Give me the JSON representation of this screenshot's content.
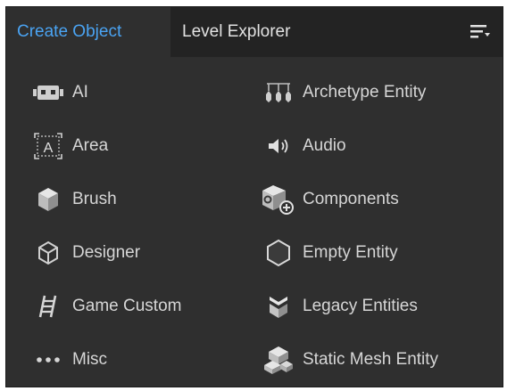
{
  "tabs": [
    {
      "label": "Create Object",
      "active": true
    },
    {
      "label": "Level Explorer",
      "active": false
    }
  ],
  "menu_icon": "sort-menu-icon",
  "colors": {
    "accent": "#4aa3f2",
    "panel_bg": "#2f2f2f",
    "tabbar_bg": "#232323",
    "text": "#d6d6d6"
  },
  "left_items": [
    {
      "label": "AI",
      "icon": "ai-robot-icon"
    },
    {
      "label": "Area",
      "icon": "area-icon"
    },
    {
      "label": "Brush",
      "icon": "brush-cube-icon"
    },
    {
      "label": "Designer",
      "icon": "designer-hexagon-icon"
    },
    {
      "label": "Game Custom",
      "icon": "ladder-icon"
    },
    {
      "label": "Misc",
      "icon": "ellipsis-icon"
    }
  ],
  "right_items": [
    {
      "label": "Archetype Entity",
      "icon": "archetype-icon"
    },
    {
      "label": "Audio",
      "icon": "speaker-icon"
    },
    {
      "label": "Components",
      "icon": "components-icon"
    },
    {
      "label": "Empty Entity",
      "icon": "hexagon-icon"
    },
    {
      "label": "Legacy Entities",
      "icon": "legacy-entity-icon"
    },
    {
      "label": "Static Mesh Entity",
      "icon": "static-mesh-icon"
    }
  ]
}
